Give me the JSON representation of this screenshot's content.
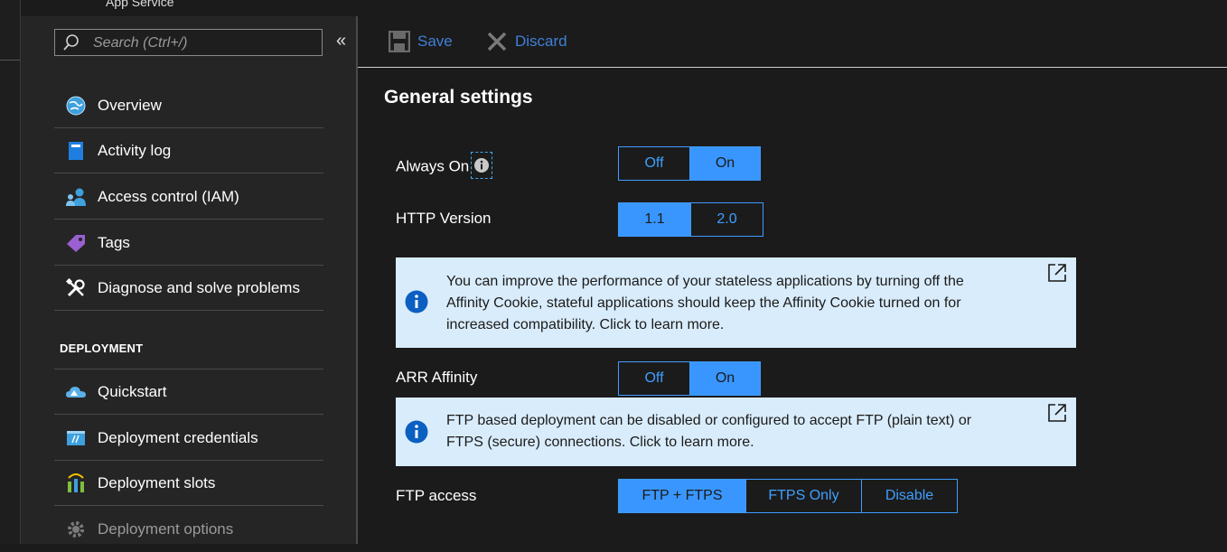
{
  "app": {
    "title": "App Service"
  },
  "search": {
    "placeholder": "Search (Ctrl+/)"
  },
  "menu": {
    "collapse_glyph": "«",
    "items": [
      {
        "label": "Overview",
        "icon": "globe-icon"
      },
      {
        "label": "Activity log",
        "icon": "book-icon"
      },
      {
        "label": "Access control (IAM)",
        "icon": "users-icon"
      },
      {
        "label": "Tags",
        "icon": "tag-icon"
      },
      {
        "label": "Diagnose and solve problems",
        "icon": "wrench-icon"
      }
    ],
    "section": "DEPLOYMENT",
    "deployment_items": [
      {
        "label": "Quickstart",
        "icon": "cloud-icon"
      },
      {
        "label": "Deployment credentials",
        "icon": "credentials-icon"
      },
      {
        "label": "Deployment slots",
        "icon": "slots-icon"
      },
      {
        "label": "Deployment options",
        "icon": "gear-icon",
        "disabled": true
      }
    ]
  },
  "toolbar": {
    "save_label": "Save",
    "discard_label": "Discard"
  },
  "main": {
    "title": "General settings",
    "always_on": {
      "label": "Always On",
      "options": [
        "Off",
        "On"
      ],
      "selected": "On"
    },
    "http_version": {
      "label": "HTTP Version",
      "options": [
        "1.1",
        "2.0"
      ],
      "selected": "1.1"
    },
    "affinity_info": "You can improve the performance of your stateless applications by turning off the Affinity Cookie, stateful applications should keep the Affinity Cookie turned on for increased compatibility. Click to learn more.",
    "arr_affinity": {
      "label": "ARR Affinity",
      "options": [
        "Off",
        "On"
      ],
      "selected": "On"
    },
    "ftp_info": "FTP based deployment can be disabled or configured to accept FTP (plain text) or FTPS (secure) connections. Click to learn more.",
    "ftp_access": {
      "label": "FTP access",
      "options": [
        "FTP + FTPS",
        "FTPS Only",
        "Disable"
      ],
      "selected": "FTP + FTPS"
    }
  },
  "colors": {
    "accent": "#3a96ff",
    "info_bg": "#d9ecfb",
    "link": "#3f7fd6",
    "info_icon": "#0b5fc1"
  }
}
